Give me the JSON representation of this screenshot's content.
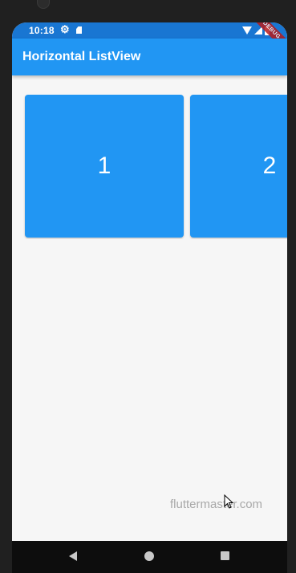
{
  "status_bar": {
    "time": "10:18",
    "icons": [
      "gear-icon",
      "sd-card-icon",
      "wifi-icon",
      "signal-icon",
      "battery-icon"
    ]
  },
  "debug_banner": "DEBUG",
  "app_bar": {
    "title": "Horizontal ListView",
    "color": "#2196f3"
  },
  "list": {
    "items": [
      {
        "label": "1"
      },
      {
        "label": "2"
      }
    ],
    "item_color": "#2196f3"
  },
  "watermark": "fluttermaster.com",
  "nav_bar": {
    "icons": [
      "back-icon",
      "home-icon",
      "recents-icon"
    ]
  }
}
